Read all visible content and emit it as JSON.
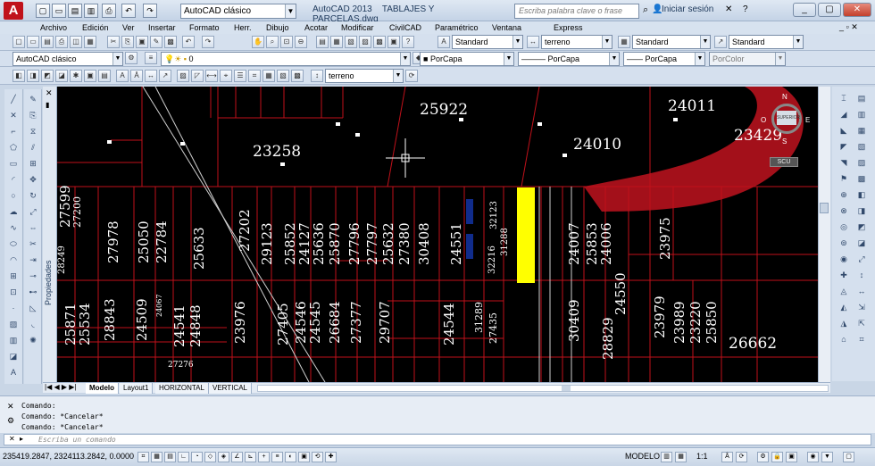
{
  "app": {
    "title": "AutoCAD 2013",
    "file": "TABLAJES Y PARCELAS.dwg",
    "workspace": "AutoCAD clásico",
    "search_placeholder": "Escriba palabra clave o frase",
    "signin": "Iniciar sesión"
  },
  "menu": [
    "Archivo",
    "Edición",
    "Ver",
    "Insertar",
    "Formato",
    "Herr.",
    "Dibujo",
    "Acotar",
    "Modificar",
    "CivilCAD",
    "Paramétrico",
    "Ventana",
    "Express"
  ],
  "styles": {
    "text_style": "Standard",
    "dim_style": "terreno",
    "table_style": "Standard",
    "mleader_style": "Standard"
  },
  "layers": {
    "workspace2": "AutoCAD clásico",
    "current_layer": "0",
    "color": "PorCapa",
    "linetype": "PorCapa",
    "lineweight": "PorCapa",
    "plotstyle": "PorColor",
    "dimstyle2": "terreno"
  },
  "panel": {
    "properties": "Propiedades"
  },
  "viewcube": {
    "top": "SUPERIOR",
    "n": "N",
    "s": "S",
    "e": "E",
    "o": "O",
    "ucs": "SCU"
  },
  "tabs": [
    "Modelo",
    "Layout1",
    "HORIZONTAL",
    "VERTICAL"
  ],
  "command": {
    "history": [
      "Comando:",
      "Comando: *Cancelar*",
      "Comando: *Cancelar*"
    ],
    "placeholder": "Escriba un comando"
  },
  "status": {
    "coords": "235419.2847, 2324113.2842, 0.0000",
    "mode": "MODELO",
    "scale": "1:1"
  },
  "drawing": {
    "big_labels": [
      "25922",
      "24011",
      "23258",
      "24010",
      "23429",
      "26662"
    ],
    "vertical_labels": [
      "27599",
      "27200",
      "27978",
      "25050",
      "22784",
      "25633",
      "27202",
      "29123",
      "25852",
      "24127",
      "25636",
      "25870",
      "27796",
      "27797",
      "25632",
      "27380",
      "30408",
      "24551",
      "32123",
      "31288",
      "32216",
      "24007",
      "25853",
      "24006",
      "23975",
      "25871",
      "25534",
      "28843",
      "24509",
      "24541",
      "24848",
      "23976",
      "27405",
      "24546",
      "24545",
      "26684",
      "27377",
      "29707",
      "24544",
      "31289",
      "27435",
      "30409",
      "28829",
      "24550",
      "23979",
      "23989",
      "23220",
      "25850",
      "28249",
      "24067",
      "27276"
    ]
  },
  "colors": {
    "canvas": "#000000",
    "parcel_lines": "#c0111a",
    "highlight": "#ffff00",
    "arc": "#a3101a"
  }
}
